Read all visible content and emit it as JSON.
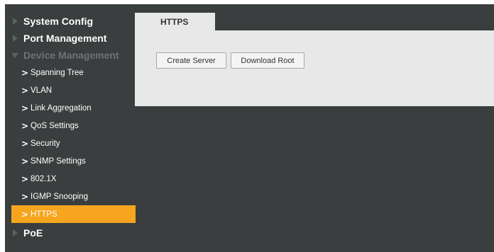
{
  "sidebar": {
    "sections": [
      {
        "label": "System Config"
      },
      {
        "label": "Port Management"
      },
      {
        "label": "Device Management"
      }
    ],
    "subitems": [
      {
        "label": "Spanning Tree"
      },
      {
        "label": "VLAN"
      },
      {
        "label": "Link Aggregation"
      },
      {
        "label": "QoS Settings"
      },
      {
        "label": "Security"
      },
      {
        "label": "SNMP Settings"
      },
      {
        "label": "802.1X"
      },
      {
        "label": "IGMP Snooping"
      },
      {
        "label": "HTTPS"
      }
    ],
    "poe": {
      "label": "PoE"
    }
  },
  "tab": {
    "label": "HTTPS"
  },
  "buttons": {
    "create_server": "Create Server",
    "download_root": "Download Root"
  },
  "colors": {
    "active_item": "#f7a51e",
    "background": "#3a3e3e",
    "panel": "#e8e8e8"
  }
}
